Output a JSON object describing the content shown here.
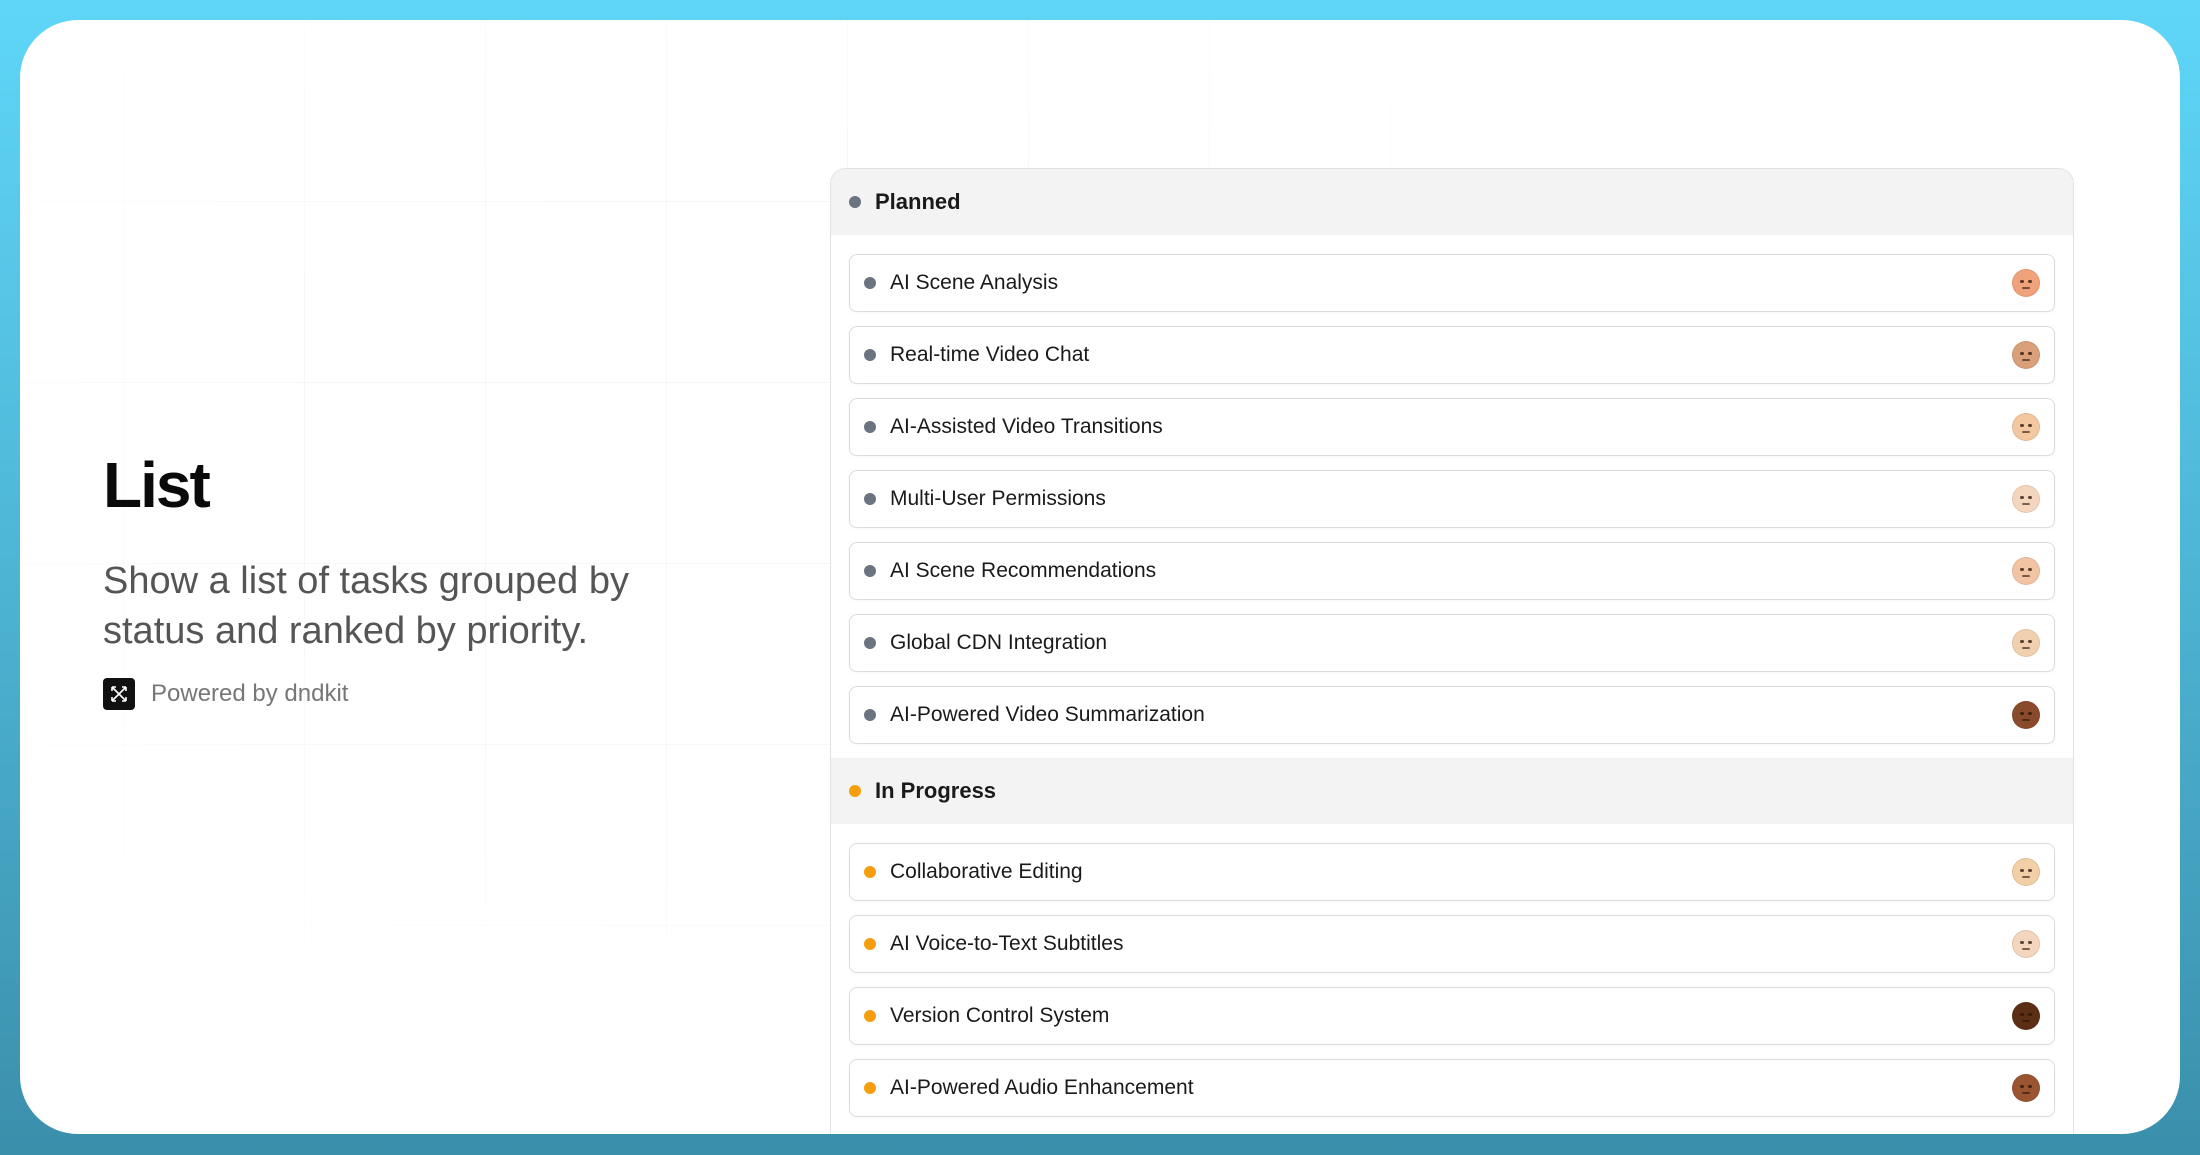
{
  "intro": {
    "title": "List",
    "subtitle": "Show a list of tasks grouped by status and ranked by priority.",
    "powered_by": "Powered by dndkit",
    "logo_icon": "dndkit-logo-icon"
  },
  "colors": {
    "planned": "#6b7280",
    "in_progress": "#f59e0b"
  },
  "groups": [
    {
      "label": "Planned",
      "status": "planned",
      "items": [
        {
          "label": "AI Scene Analysis",
          "avatar_color": "#f0a27a"
        },
        {
          "label": "Real-time Video Chat",
          "avatar_color": "#d9a07a"
        },
        {
          "label": "AI-Assisted Video Transitions",
          "avatar_color": "#f3c7a0"
        },
        {
          "label": "Multi-User Permissions",
          "avatar_color": "#f4d6bf"
        },
        {
          "label": "AI Scene Recommendations",
          "avatar_color": "#f2c4a4"
        },
        {
          "label": "Global CDN Integration",
          "avatar_color": "#f1d0b0"
        },
        {
          "label": "AI-Powered Video Summarization",
          "avatar_color": "#8a4b2c"
        }
      ]
    },
    {
      "label": "In Progress",
      "status": "in_progress",
      "items": [
        {
          "label": "Collaborative Editing",
          "avatar_color": "#f3cfa8"
        },
        {
          "label": "AI Voice-to-Text Subtitles",
          "avatar_color": "#f4d5bd"
        },
        {
          "label": "Version Control System",
          "avatar_color": "#5c2f14"
        },
        {
          "label": "AI-Powered Audio Enhancement",
          "avatar_color": "#9a5530"
        }
      ]
    }
  ]
}
